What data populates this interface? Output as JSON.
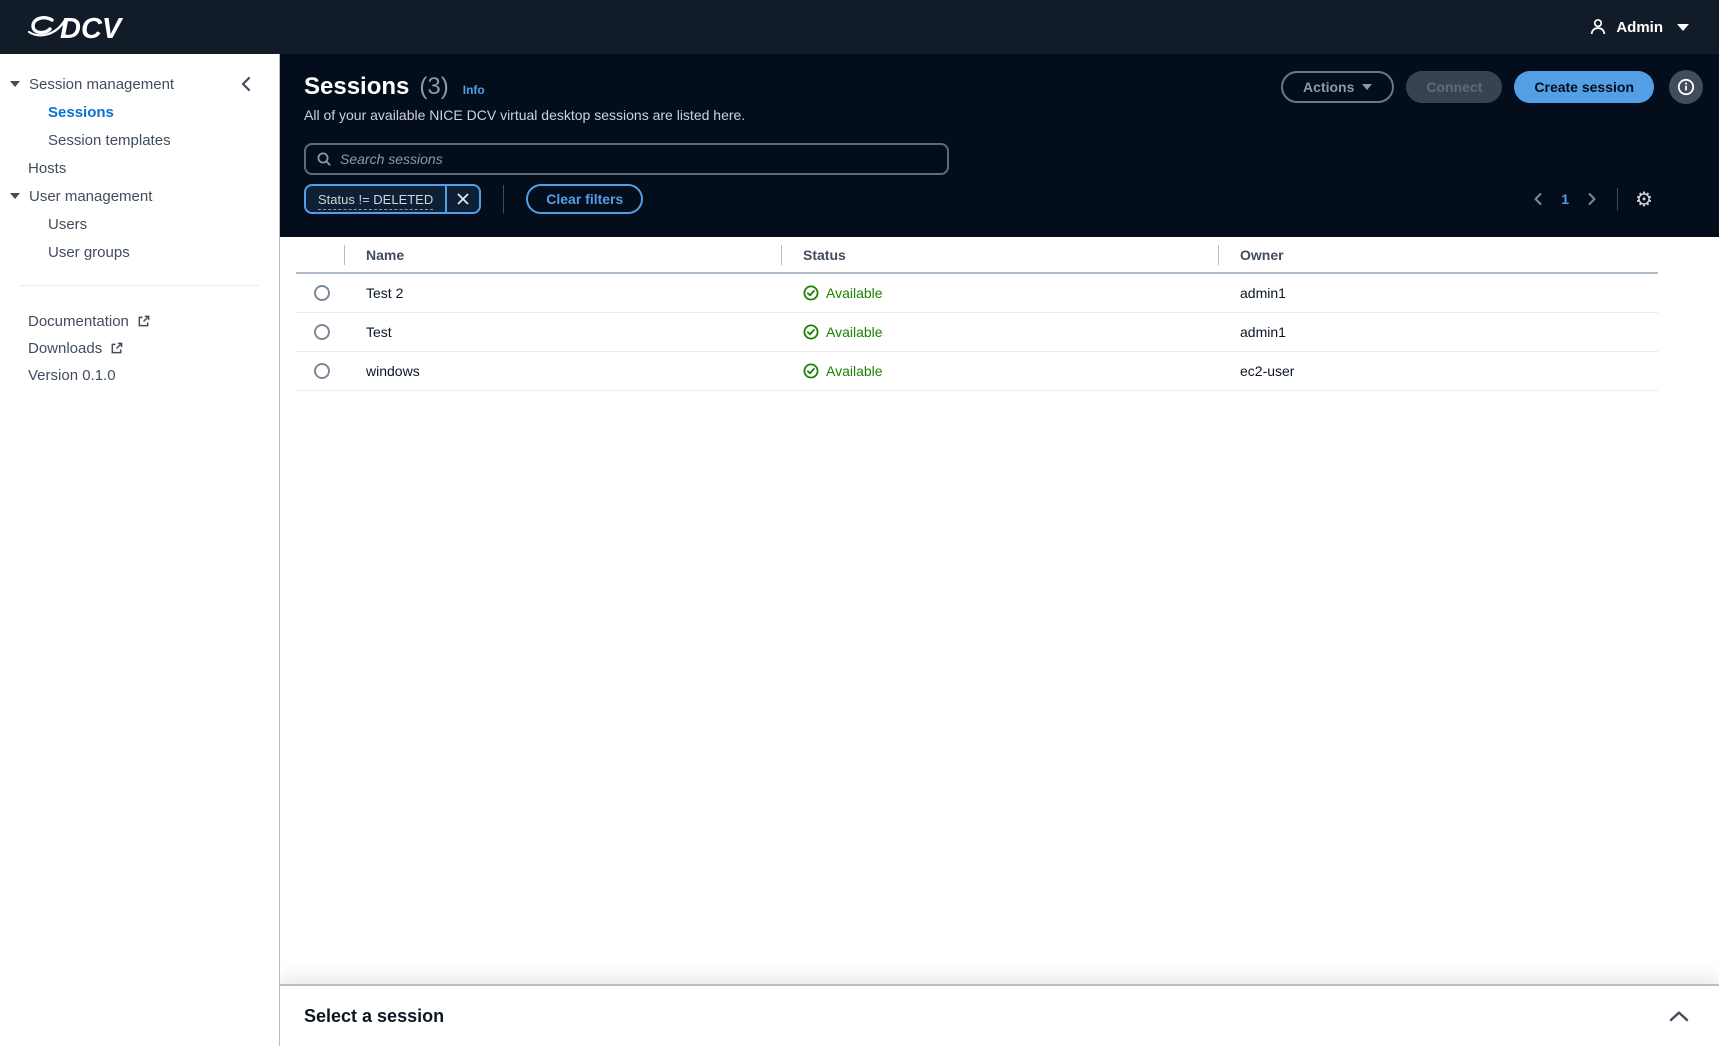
{
  "topbar": {
    "logo_text": "DCV",
    "user_name": "Admin"
  },
  "sidebar": {
    "items": [
      {
        "label": "Session management",
        "type": "section-expanded"
      },
      {
        "label": "Sessions",
        "type": "sub",
        "active": true
      },
      {
        "label": "Session templates",
        "type": "sub"
      },
      {
        "label": "Hosts",
        "type": "top"
      },
      {
        "label": "User management",
        "type": "section-expanded"
      },
      {
        "label": "Users",
        "type": "sub"
      },
      {
        "label": "User groups",
        "type": "sub"
      }
    ],
    "links": [
      {
        "label": "Documentation",
        "external": true
      },
      {
        "label": "Downloads",
        "external": true
      }
    ],
    "version": "Version 0.1.0"
  },
  "header": {
    "title": "Sessions",
    "count": "(3)",
    "info_label": "Info",
    "subtitle": "All of your available NICE DCV virtual desktop sessions are listed here.",
    "buttons": {
      "actions": "Actions",
      "connect": "Connect",
      "create": "Create session"
    }
  },
  "toolbar": {
    "search_placeholder": "Search sessions",
    "filter_chip": "Status != DELETED",
    "clear_filters": "Clear filters",
    "page": "1"
  },
  "table": {
    "columns": [
      "Name",
      "Status",
      "Owner"
    ],
    "rows": [
      {
        "name": "Test 2",
        "status": "Available",
        "owner": "admin1"
      },
      {
        "name": "Test",
        "status": "Available",
        "owner": "admin1"
      },
      {
        "name": "windows",
        "status": "Available",
        "owner": "ec2-user"
      }
    ]
  },
  "split_panel": {
    "title": "Select a session"
  },
  "icons": {
    "settings_glyph": "⚙"
  },
  "colors": {
    "topbar_bg": "#121b28",
    "header_bg": "#040d1b",
    "accent_blue_dark": "#539fe5",
    "link_blue_light": "#0972d3",
    "status_green": "#1d8102"
  }
}
